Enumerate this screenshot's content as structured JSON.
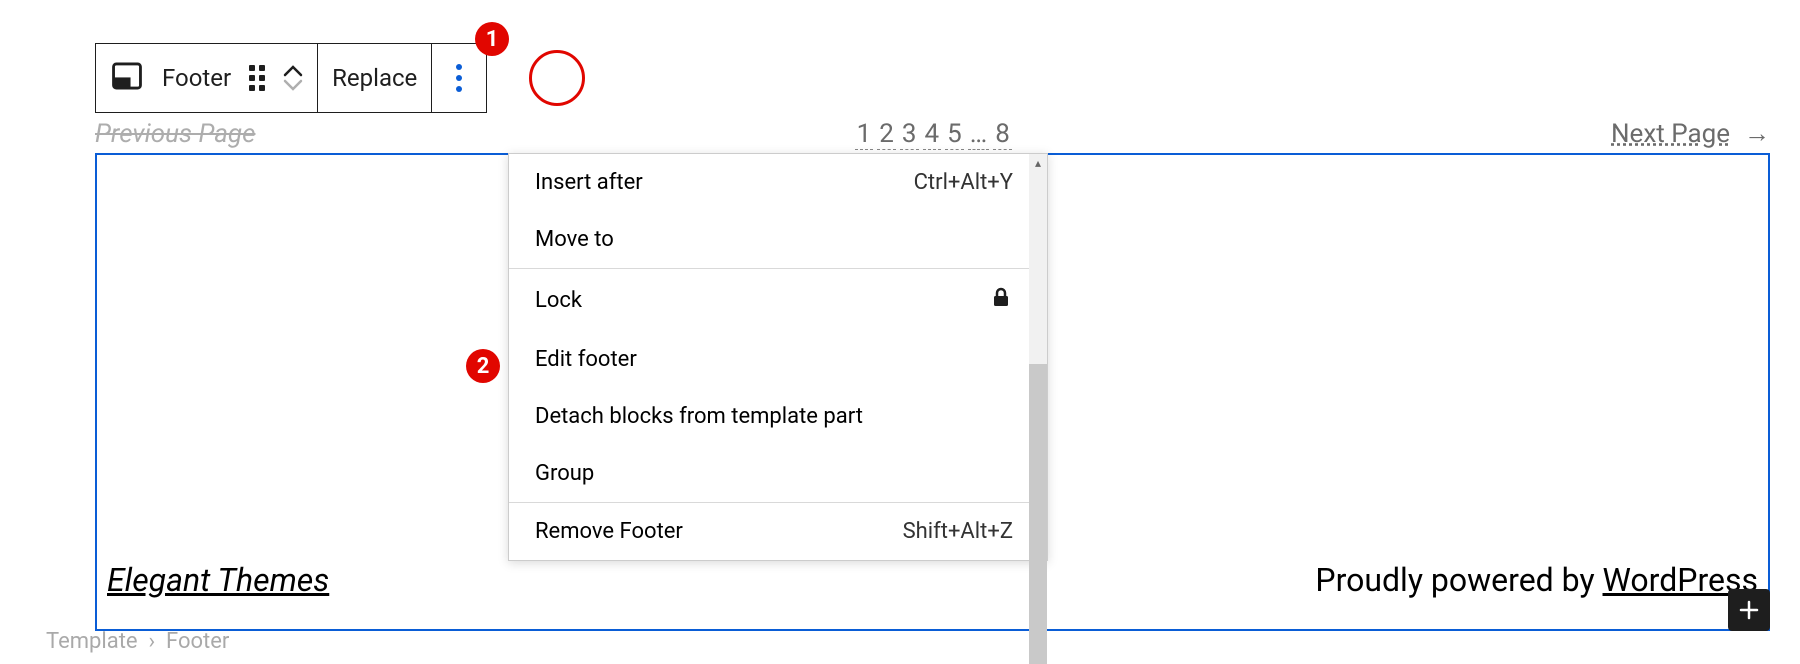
{
  "toolbar": {
    "block_label": "Footer",
    "replace_label": "Replace"
  },
  "annotations": {
    "one": "1",
    "two": "2"
  },
  "pager": {
    "prev": "Previous Page",
    "pages": [
      "1",
      "2",
      "3",
      "4",
      "5",
      "…",
      "8"
    ],
    "next": "Next Page"
  },
  "footer": {
    "site_title": "Elegant Themes",
    "credit_prefix": "Proudly powered by ",
    "credit_link": "WordPress"
  },
  "menu": {
    "insert_after": "Insert after",
    "insert_after_shortcut": "Ctrl+Alt+Y",
    "move_to": "Move to",
    "lock": "Lock",
    "edit_footer": "Edit footer",
    "detach": "Detach blocks from template part",
    "group": "Group",
    "remove": "Remove Footer",
    "remove_shortcut": "Shift+Alt+Z"
  },
  "breadcrumb": {
    "template": "Template",
    "sep": "›",
    "footer": "Footer"
  }
}
